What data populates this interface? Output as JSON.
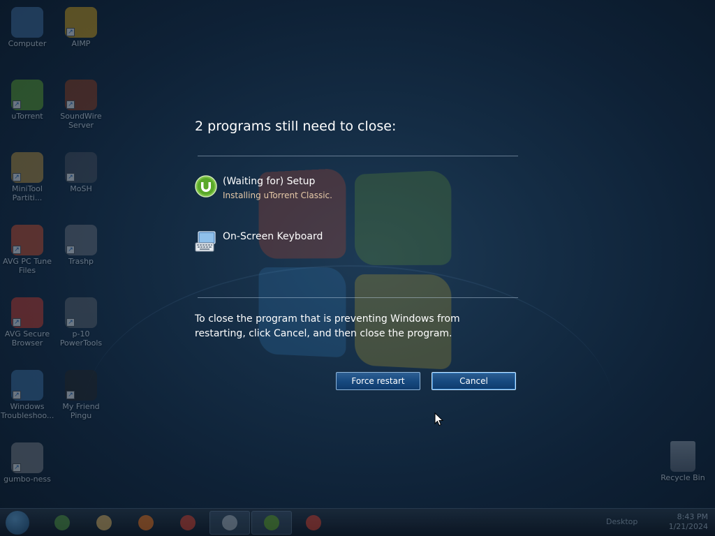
{
  "dialog": {
    "title": "2 programs still need to close:",
    "programs": [
      {
        "name": "(Waiting for) Setup",
        "description": "Installing uTorrent Classic.",
        "icon": "utorrent-icon"
      },
      {
        "name": "On-Screen Keyboard",
        "description": "",
        "icon": "keyboard-icon"
      }
    ],
    "message": "To close the program that is preventing Windows from restarting, click Cancel, and then close the program.",
    "buttons": {
      "force_restart": "Force restart",
      "cancel": "Cancel"
    }
  },
  "desktop": {
    "icons": [
      {
        "label": "Computer",
        "icon": "computer-icon",
        "color": "#3d6a9a"
      },
      {
        "label": "AIMP",
        "icon": "aimp-icon",
        "color": "#c99a1a"
      },
      {
        "label": "uTorrent",
        "icon": "utorrent-icon",
        "color": "#5a9a2a"
      },
      {
        "label": "SoundWire Server",
        "icon": "soundwire-icon",
        "color": "#8a3a1a"
      },
      {
        "label": "MiniTool Partiti...",
        "icon": "minitool-icon",
        "color": "#b08a3a"
      },
      {
        "label": "MoSH",
        "icon": "mosh-icon",
        "color": "#444a55"
      },
      {
        "label": "AVG PC Tune Files",
        "icon": "avg-tune-icon",
        "color": "#c44a2a"
      },
      {
        "label": "Trashp",
        "icon": "trash-icon",
        "color": "#666c75"
      },
      {
        "label": "AVG Secure Browser",
        "icon": "avg-browser-icon",
        "color": "#c43a2a"
      },
      {
        "label": "p-10 PowerTools",
        "icon": "powertools-icon",
        "color": "#5a5f66"
      },
      {
        "label": "Windows Troubleshoo...",
        "icon": "troubleshoot-icon",
        "color": "#3a6a9a"
      },
      {
        "label": "My Friend Pingu",
        "icon": "pingu-icon",
        "color": "#222222"
      },
      {
        "label": "gumbo-ness",
        "icon": "gumbo-icon",
        "color": "#777a80"
      }
    ],
    "recycle_bin": {
      "label": "Recycle Bin",
      "icon": "recycle-bin-icon"
    }
  },
  "taskbar": {
    "items": [
      {
        "icon": "file-explorer-icon",
        "color": "#4a8a3a"
      },
      {
        "icon": "folder-icon",
        "color": "#c9a25a"
      },
      {
        "icon": "media-player-icon",
        "color": "#d86a1a"
      },
      {
        "icon": "chrome-icon",
        "color": "#c43a2a"
      },
      {
        "icon": "onscreen-keyboard-icon",
        "color": "#9aa6b2"
      },
      {
        "icon": "utorrent-icon",
        "color": "#5a9a2a"
      },
      {
        "icon": "chrome-icon",
        "color": "#c43a2a"
      }
    ],
    "tray_text": "Desktop",
    "time": "8:43 PM",
    "date": "1/21/2024"
  }
}
